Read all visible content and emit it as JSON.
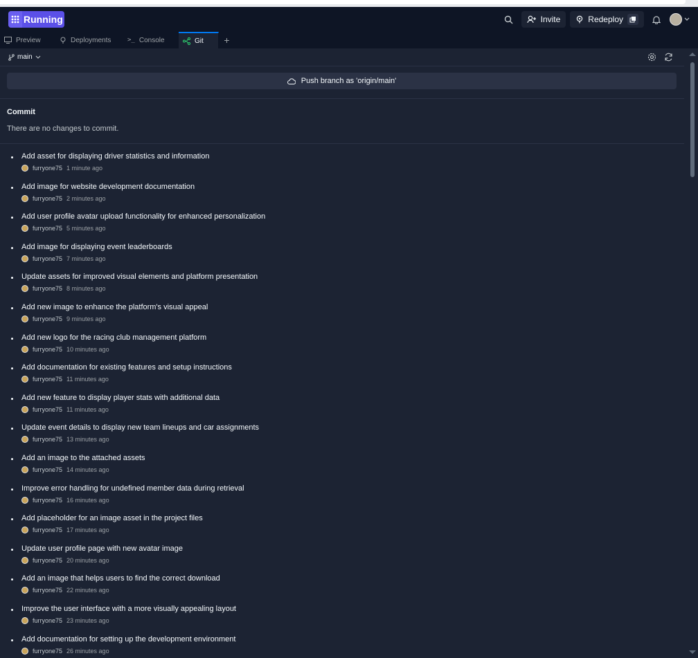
{
  "topbar": {
    "status_label": "Running",
    "invite_label": "Invite",
    "redeploy_label": "Redeploy"
  },
  "tabs": [
    {
      "label": "Preview",
      "icon": "monitor-icon"
    },
    {
      "label": "Deployments",
      "icon": "deploy-icon"
    },
    {
      "label": "Console",
      "icon": "terminal-icon"
    },
    {
      "label": "Git",
      "icon": "git-icon",
      "active": true
    }
  ],
  "git": {
    "branch": "main",
    "push_label": "Push branch as 'origin/main'",
    "commit_heading": "Commit",
    "no_changes": "There are no changes to commit."
  },
  "commits": [
    {
      "message": "Add asset for displaying driver statistics and information",
      "author": "furryone75",
      "time": "1 minute ago"
    },
    {
      "message": "Add image for website development documentation",
      "author": "furryone75",
      "time": "2 minutes ago"
    },
    {
      "message": "Add user profile avatar upload functionality for enhanced personalization",
      "author": "furryone75",
      "time": "5 minutes ago"
    },
    {
      "message": "Add image for displaying event leaderboards",
      "author": "furryone75",
      "time": "7 minutes ago"
    },
    {
      "message": "Update assets for improved visual elements and platform presentation",
      "author": "furryone75",
      "time": "8 minutes ago"
    },
    {
      "message": "Add new image to enhance the platform's visual appeal",
      "author": "furryone75",
      "time": "9 minutes ago"
    },
    {
      "message": "Add new logo for the racing club management platform",
      "author": "furryone75",
      "time": "10 minutes ago"
    },
    {
      "message": "Add documentation for existing features and setup instructions",
      "author": "furryone75",
      "time": "11 minutes ago"
    },
    {
      "message": "Add new feature to display player stats with additional data",
      "author": "furryone75",
      "time": "11 minutes ago"
    },
    {
      "message": "Update event details to display new team lineups and car assignments",
      "author": "furryone75",
      "time": "13 minutes ago"
    },
    {
      "message": "Add an image to the attached assets",
      "author": "furryone75",
      "time": "14 minutes ago"
    },
    {
      "message": "Improve error handling for undefined member data during retrieval",
      "author": "furryone75",
      "time": "16 minutes ago"
    },
    {
      "message": "Add placeholder for an image asset in the project files",
      "author": "furryone75",
      "time": "17 minutes ago"
    },
    {
      "message": "Update user profile page with new avatar image",
      "author": "furryone75",
      "time": "20 minutes ago"
    },
    {
      "message": "Add an image that helps users to find the correct download",
      "author": "furryone75",
      "time": "22 minutes ago"
    },
    {
      "message": "Improve the user interface with a more visually appealing layout",
      "author": "furryone75",
      "time": "23 minutes ago"
    },
    {
      "message": "Add documentation for setting up the development environment",
      "author": "furryone75",
      "time": "26 minutes ago"
    }
  ],
  "colors": {
    "background": "#1c2333",
    "topbar": "#0e1525",
    "accent": "#5b50e8",
    "active_tab": "#0079f2"
  }
}
